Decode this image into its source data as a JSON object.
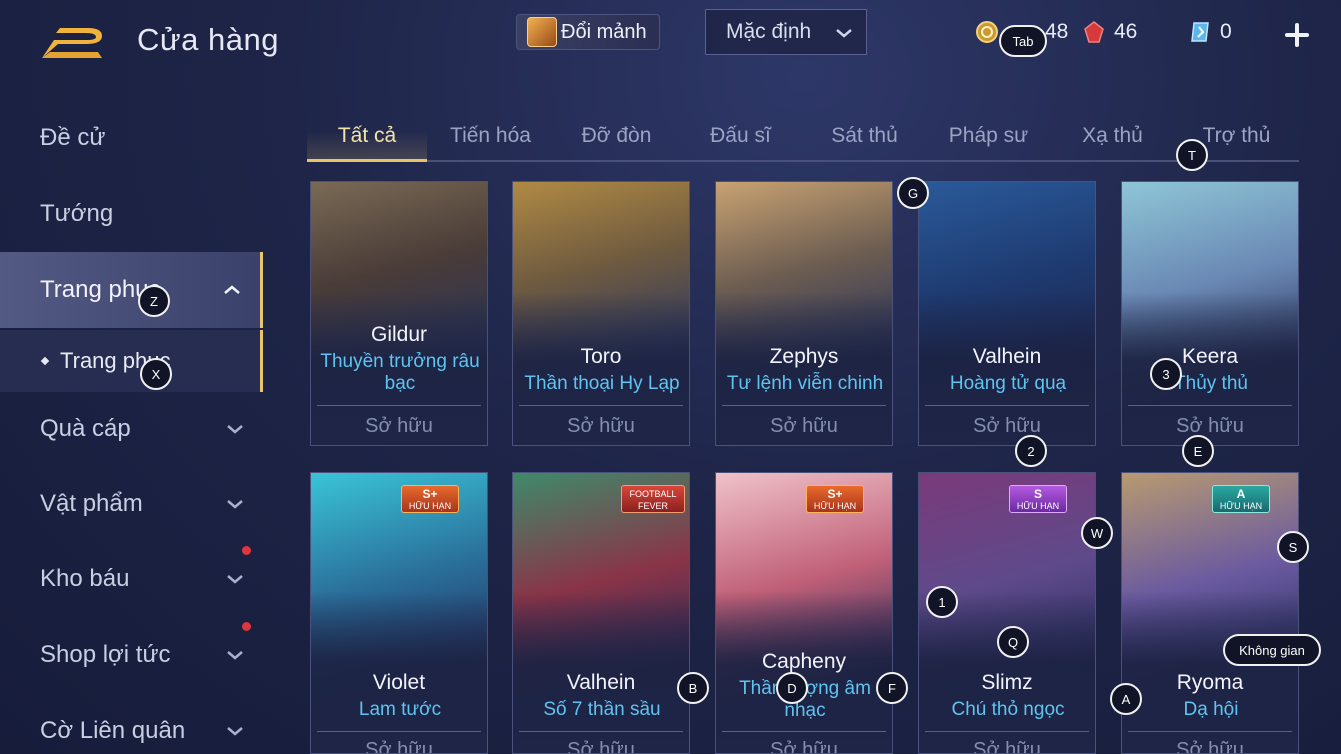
{
  "header": {
    "title": "Cửa hàng",
    "exchange_label": "Đổi mảnh",
    "sort_label": "Mặc định",
    "currencies": [
      {
        "icon": "gold-coin-icon",
        "value": "48"
      },
      {
        "icon": "red-gem-icon",
        "value": "46"
      },
      {
        "icon": "voucher-icon",
        "value": "0"
      }
    ]
  },
  "sidebar": {
    "items": [
      {
        "label": "Đề cử"
      },
      {
        "label": "Tướng"
      },
      {
        "label": "Trang phục"
      },
      {
        "label": "Trang phục"
      },
      {
        "label": "Quà cáp"
      },
      {
        "label": "Vật phẩm"
      },
      {
        "label": "Kho báu"
      },
      {
        "label": "Shop lợi tức"
      },
      {
        "label": "Cờ Liên quân"
      }
    ]
  },
  "tabs": [
    "Tất cả",
    "Tiến hóa",
    "Đỡ đòn",
    "Đấu sĩ",
    "Sát thủ",
    "Pháp sư",
    "Xạ thủ",
    "Trợ thủ"
  ],
  "cards": [
    {
      "hero": "Gildur",
      "skin": "Thuyền trưởng râu bạc",
      "status": "Sở hữu"
    },
    {
      "hero": "Toro",
      "skin": "Thần thoại Hy Lạp",
      "status": "Sở hữu"
    },
    {
      "hero": "Zephys",
      "skin": "Tư lệnh viễn chinh",
      "status": "Sở hữu"
    },
    {
      "hero": "Valhein",
      "skin": "Hoàng tử quạ",
      "status": "Sở hữu"
    },
    {
      "hero": "Keera",
      "skin": "Thủy thủ",
      "status": "Sở hữu"
    },
    {
      "hero": "Violet",
      "skin": "Lam tước",
      "status": "Sở hữu",
      "tier": "S+",
      "tier_sub": "HỮU HẠN"
    },
    {
      "hero": "Valhein",
      "skin": "Số 7 thần sầu",
      "status": "Sở hữu",
      "badge": "FOOTBALL FEVER"
    },
    {
      "hero": "Capheny",
      "skin": "Thần tượng âm nhạc",
      "status": "Sở hữu",
      "tier": "S+",
      "tier_sub": "HỮU HẠN"
    },
    {
      "hero": "Slimz",
      "skin": "Chú thỏ ngọc",
      "status": "Sở hữu",
      "tier": "S",
      "tier_sub": "HỮU HẠN"
    },
    {
      "hero": "Ryoma",
      "skin": "Dạ hội",
      "status": "Sở hữu",
      "tier": "A",
      "tier_sub": "HỮU HẠN"
    }
  ],
  "hotkeys": {
    "tab": "Tab",
    "t": "T",
    "g": "G",
    "z": "Z",
    "x": "X",
    "three": "3",
    "two": "2",
    "e": "E",
    "w": "W",
    "s": "S",
    "one": "1",
    "q": "Q",
    "space": "Không gian",
    "a": "A",
    "b": "B",
    "d": "D",
    "f": "F"
  },
  "colors": {
    "accent_gold": "#e8c468",
    "skin_name": "#5fc4f0",
    "red_dot": "#e0353d"
  }
}
